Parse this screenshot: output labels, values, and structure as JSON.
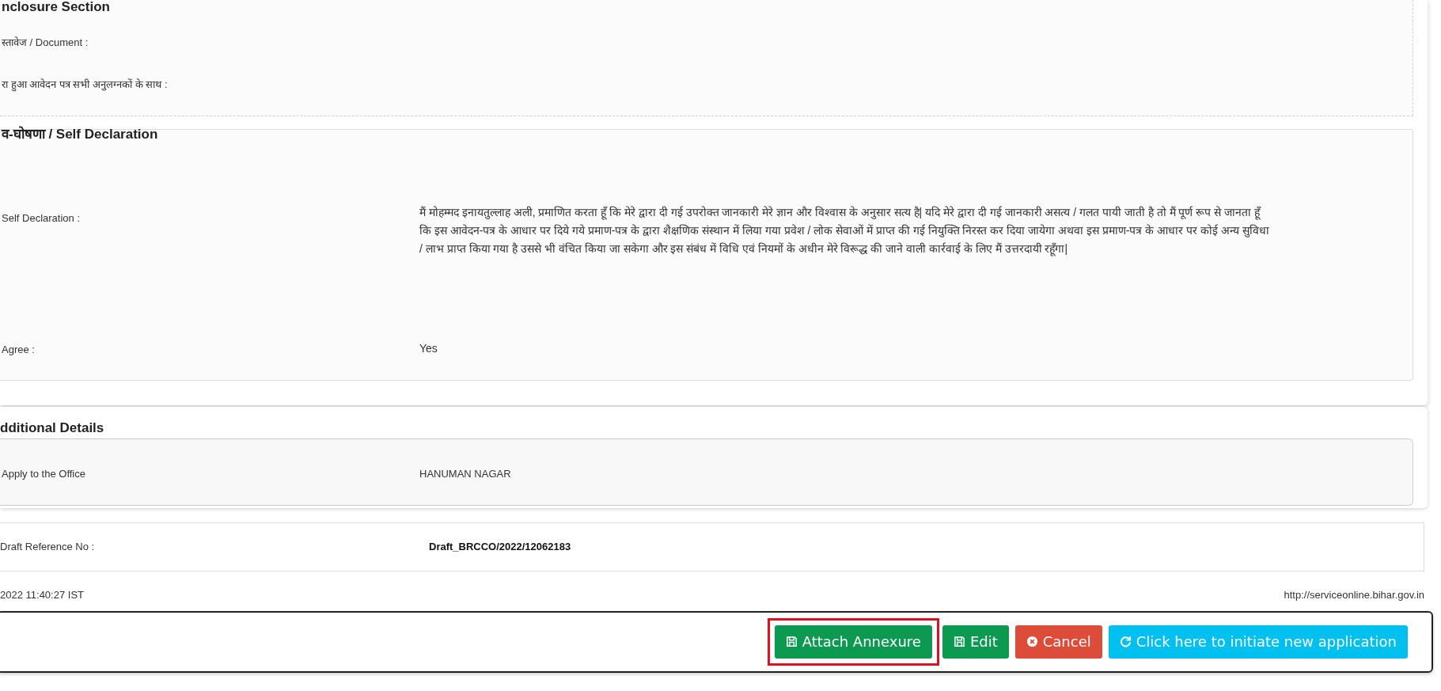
{
  "enclosure": {
    "title": "nclosure Section",
    "fields": [
      {
        "label": "स्तावेज / Document :"
      },
      {
        "label": "रा हुआ आवेदन पत्र सभी अनुलग्नकों के साथ :"
      }
    ]
  },
  "declaration": {
    "title": "व-घोषणा / Self Declaration",
    "fields": [
      {
        "label": "Self Declaration :",
        "value": "मैं मोहम्मद इनायतुल्लाह अली, प्रमाणित करता हूँ कि मेरे द्वारा दी गई उपरोक्त जानकारी मेरे ज्ञान और विश्वास के अनुसार सत्य है| यदि मेरे द्वारा दी गई जानकारी असत्य / गलत पायी जाती है तो मैं पूर्ण रूप से जानता हूँ कि इस आवेदन-पत्र के आधार पर दिये गये प्रमाण-पत्र के द्वारा शैक्षणिक संस्थान में लिया गया प्रवेश / लोक सेवाओं में प्राप्त की गई नियुक्ति निरस्त कर दिया जायेगा अथवा इस प्रमाण-पत्र के आधार पर कोई अन्य सुविधा / लाभ प्राप्त किया गया है उससे भी वंचित किया जा सकेगा और इस संबंध में विधि एवं नियमों के अधीन मेरे विरूद्ध की जाने वाली कार्रवाई के लिए मैं उत्तरदायी रहूँगा|"
      },
      {
        "label": "Agree :",
        "value": "Yes"
      }
    ]
  },
  "additional": {
    "title": "dditional Details",
    "fields": [
      {
        "label": "Apply to the Office",
        "value": "HANUMAN NAGAR"
      }
    ]
  },
  "draft": {
    "label": "Draft Reference No :",
    "value": "Draft_BRCCO/2022/12062183"
  },
  "footer": {
    "timestamp": "2022 11:40:27 IST",
    "url": "http://serviceonline.bihar.gov.in"
  },
  "buttons": [
    {
      "label": "Attach Annexure",
      "kind": "save",
      "highlighted": true
    },
    {
      "label": "Edit",
      "kind": "save",
      "highlighted": false
    },
    {
      "label": "Cancel",
      "kind": "cancel",
      "highlighted": false
    },
    {
      "label": "Click here to initiate new application",
      "kind": "refresh",
      "highlighted": false
    }
  ]
}
